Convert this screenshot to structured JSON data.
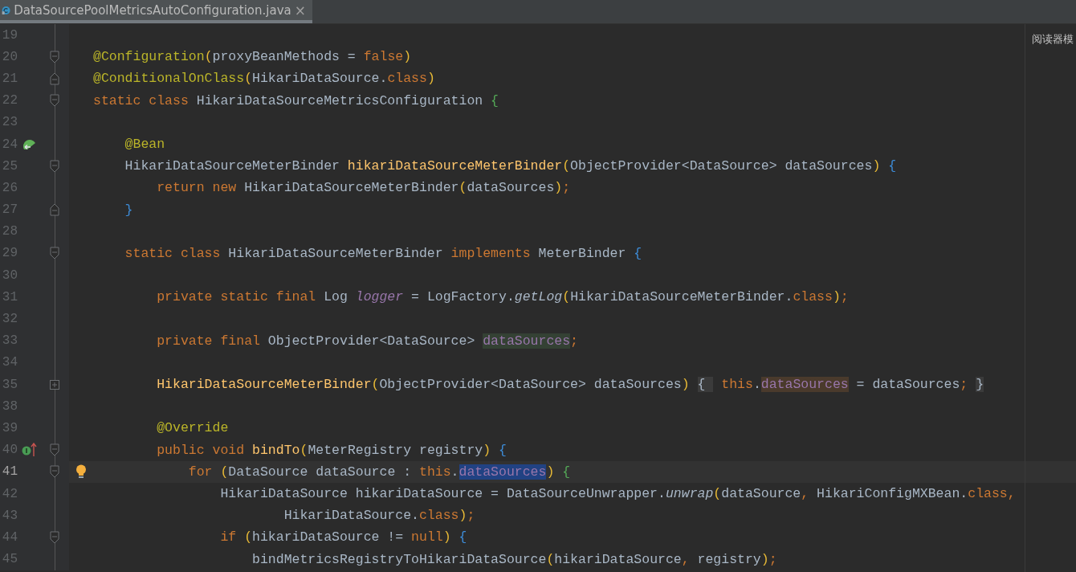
{
  "tab": {
    "title": "DataSourcePoolMetricsAutoConfiguration.java",
    "close": "×",
    "selected": true
  },
  "overlay_label": "阅读器模",
  "lines": [
    {
      "number": "19",
      "current": false
    },
    {
      "number": "20",
      "current": false,
      "fold": {
        "kind": "start"
      },
      "tokens": [
        {
          "t": "@Configuration",
          "kind": "ann"
        },
        {
          "t": "(",
          "kind": "paren"
        },
        {
          "t": "proxyBeanMethods = ",
          "kind": "plain"
        },
        {
          "t": "false",
          "kind": "kw"
        },
        {
          "t": ")",
          "kind": "paren"
        }
      ]
    },
    {
      "number": "21",
      "current": false,
      "fold": {
        "kind": "end"
      },
      "tokens": [
        {
          "t": "@ConditionalOnClass",
          "kind": "ann"
        },
        {
          "t": "(",
          "kind": "paren"
        },
        {
          "t": "HikariDataSource.",
          "kind": "plain"
        },
        {
          "t": "class",
          "kind": "kw"
        },
        {
          "t": ")",
          "kind": "paren"
        }
      ]
    },
    {
      "number": "22",
      "current": false,
      "fold": {
        "kind": "start"
      },
      "tokens": [
        {
          "t": "static class ",
          "kind": "kw"
        },
        {
          "t": "HikariDataSourceMetricsConfiguration ",
          "kind": "plain"
        },
        {
          "t": "{",
          "kind": "brace2"
        }
      ]
    },
    {
      "number": "23",
      "current": false
    },
    {
      "number": "24",
      "current": false,
      "marker": {
        "kind": "bean"
      },
      "tokens": [
        {
          "t": "    @Bean",
          "kind": "ann"
        }
      ]
    },
    {
      "number": "25",
      "current": false,
      "fold": {
        "kind": "start"
      },
      "tokens": [
        {
          "t": "    HikariDataSourceMeterBinder ",
          "kind": "plain"
        },
        {
          "t": "hikariDataSourceMeterBinder",
          "kind": "fn"
        },
        {
          "t": "(",
          "kind": "paren"
        },
        {
          "t": "ObjectProvider<DataSource> dataSources",
          "kind": "plain"
        },
        {
          "t": ") ",
          "kind": "paren"
        },
        {
          "t": "{",
          "kind": "brace1"
        }
      ]
    },
    {
      "number": "26",
      "current": false,
      "tokens": [
        {
          "t": "        return new ",
          "kind": "kw"
        },
        {
          "t": "HikariDataSourceMeterBinder",
          "kind": "plain"
        },
        {
          "t": "(",
          "kind": "paren"
        },
        {
          "t": "dataSources",
          "kind": "plain"
        },
        {
          "t": ")",
          "kind": "paren"
        },
        {
          "t": ";",
          "kind": "kw"
        }
      ]
    },
    {
      "number": "27",
      "current": false,
      "fold": {
        "kind": "end"
      },
      "tokens": [
        {
          "t": "    }",
          "kind": "brace1"
        }
      ]
    },
    {
      "number": "28",
      "current": false
    },
    {
      "number": "29",
      "current": false,
      "fold": {
        "kind": "start"
      },
      "tokens": [
        {
          "t": "    static class ",
          "kind": "kw"
        },
        {
          "t": "HikariDataSourceMeterBinder ",
          "kind": "plain"
        },
        {
          "t": "implements ",
          "kind": "kw"
        },
        {
          "t": "MeterBinder ",
          "kind": "plain"
        },
        {
          "t": "{",
          "kind": "brace1"
        }
      ]
    },
    {
      "number": "30",
      "current": false
    },
    {
      "number": "31",
      "current": false,
      "tokens": [
        {
          "t": "        private static final ",
          "kind": "kw"
        },
        {
          "t": "Log ",
          "kind": "plain"
        },
        {
          "t": "logger",
          "kind": "field_italic"
        },
        {
          "t": " = LogFactory.",
          "kind": "plain"
        },
        {
          "t": "getLog",
          "kind": "static_call"
        },
        {
          "t": "(",
          "kind": "paren"
        },
        {
          "t": "HikariDataSourceMeterBinder.",
          "kind": "plain"
        },
        {
          "t": "class",
          "kind": "kw"
        },
        {
          "t": ")",
          "kind": "paren"
        },
        {
          "t": ";",
          "kind": "kw"
        }
      ]
    },
    {
      "number": "32",
      "current": false
    },
    {
      "number": "33",
      "current": false,
      "tokens": [
        {
          "t": "        private final ",
          "kind": "kw"
        },
        {
          "t": "ObjectProvider<DataSource> ",
          "kind": "plain"
        },
        {
          "t": "dataSources",
          "kind": "field",
          "highlight": {
            "kind": "read"
          }
        },
        {
          "t": ";",
          "kind": "kw"
        }
      ]
    },
    {
      "number": "34",
      "current": false
    },
    {
      "number": "35",
      "current": false,
      "fold": {
        "kind": "collapsed"
      },
      "tokens": [
        {
          "t": "        HikariDataSourceMeterBinder",
          "kind": "fn"
        },
        {
          "t": "(",
          "kind": "paren"
        },
        {
          "t": "ObjectProvider<DataSource> dataSources",
          "kind": "plain"
        },
        {
          "t": ") ",
          "kind": "paren"
        },
        {
          "t": "{ ",
          "kind": "plain",
          "highlight": {
            "kind": "fold"
          }
        },
        {
          "t": " this",
          "kind": "kw"
        },
        {
          "t": ".",
          "kind": "plain"
        },
        {
          "t": "dataSources",
          "kind": "field",
          "highlight": {
            "kind": "write"
          }
        },
        {
          "t": " = dataSources",
          "kind": "plain"
        },
        {
          "t": "; ",
          "kind": "kw"
        },
        {
          "t": "}",
          "kind": "plain",
          "highlight": {
            "kind": "fold"
          }
        }
      ]
    },
    {
      "number": "38",
      "current": false
    },
    {
      "number": "39",
      "current": false,
      "tokens": [
        {
          "t": "        @Override",
          "kind": "ann"
        }
      ]
    },
    {
      "number": "40",
      "current": false,
      "marker": {
        "kind": "implements"
      },
      "fold": {
        "kind": "start"
      },
      "tokens": [
        {
          "t": "        public void ",
          "kind": "kw"
        },
        {
          "t": "bindTo",
          "kind": "fn"
        },
        {
          "t": "(",
          "kind": "paren"
        },
        {
          "t": "MeterRegistry registry",
          "kind": "plain"
        },
        {
          "t": ") ",
          "kind": "paren"
        },
        {
          "t": "{",
          "kind": "brace1"
        }
      ]
    },
    {
      "number": "41",
      "current": true,
      "intention": true,
      "fold": {
        "kind": "start"
      },
      "tokens": [
        {
          "t": "            for ",
          "kind": "kw"
        },
        {
          "t": "(",
          "kind": "paren"
        },
        {
          "t": "DataSource dataSource : ",
          "kind": "plain"
        },
        {
          "t": "this",
          "kind": "kw"
        },
        {
          "t": ".",
          "kind": "plain"
        },
        {
          "t": "dataSources",
          "kind": "field",
          "highlight": {
            "kind": "selection"
          }
        },
        {
          "t": ") ",
          "kind": "paren"
        },
        {
          "t": "{",
          "kind": "brace2"
        }
      ]
    },
    {
      "number": "42",
      "current": false,
      "tokens": [
        {
          "t": "                HikariDataSource hikariDataSource = DataSourceUnwrapper.",
          "kind": "plain"
        },
        {
          "t": "unwrap",
          "kind": "static_call"
        },
        {
          "t": "(",
          "kind": "paren"
        },
        {
          "t": "dataSource",
          "kind": "plain"
        },
        {
          "t": ", ",
          "kind": "kw"
        },
        {
          "t": "HikariConfigMXBean.",
          "kind": "plain"
        },
        {
          "t": "class",
          "kind": "kw"
        },
        {
          "t": ",",
          "kind": "kw"
        }
      ]
    },
    {
      "number": "43",
      "current": false,
      "tokens": [
        {
          "t": "                        HikariDataSource.",
          "kind": "plain"
        },
        {
          "t": "class",
          "kind": "kw"
        },
        {
          "t": ")",
          "kind": "paren"
        },
        {
          "t": ";",
          "kind": "kw"
        }
      ]
    },
    {
      "number": "44",
      "current": false,
      "fold": {
        "kind": "start"
      },
      "tokens": [
        {
          "t": "                if ",
          "kind": "kw"
        },
        {
          "t": "(",
          "kind": "paren"
        },
        {
          "t": "hikariDataSource != ",
          "kind": "plain"
        },
        {
          "t": "null",
          "kind": "kw"
        },
        {
          "t": ") ",
          "kind": "paren"
        },
        {
          "t": "{",
          "kind": "brace1"
        }
      ]
    },
    {
      "number": "45",
      "current": false,
      "tokens": [
        {
          "t": "                    bindMetricsRegistryToHikariDataSource",
          "kind": "plain"
        },
        {
          "t": "(",
          "kind": "paren"
        },
        {
          "t": "hikariDataSource",
          "kind": "plain"
        },
        {
          "t": ", ",
          "kind": "kw"
        },
        {
          "t": "registry",
          "kind": "plain"
        },
        {
          "t": ")",
          "kind": "paren"
        },
        {
          "t": ";",
          "kind": "kw"
        }
      ]
    }
  ]
}
